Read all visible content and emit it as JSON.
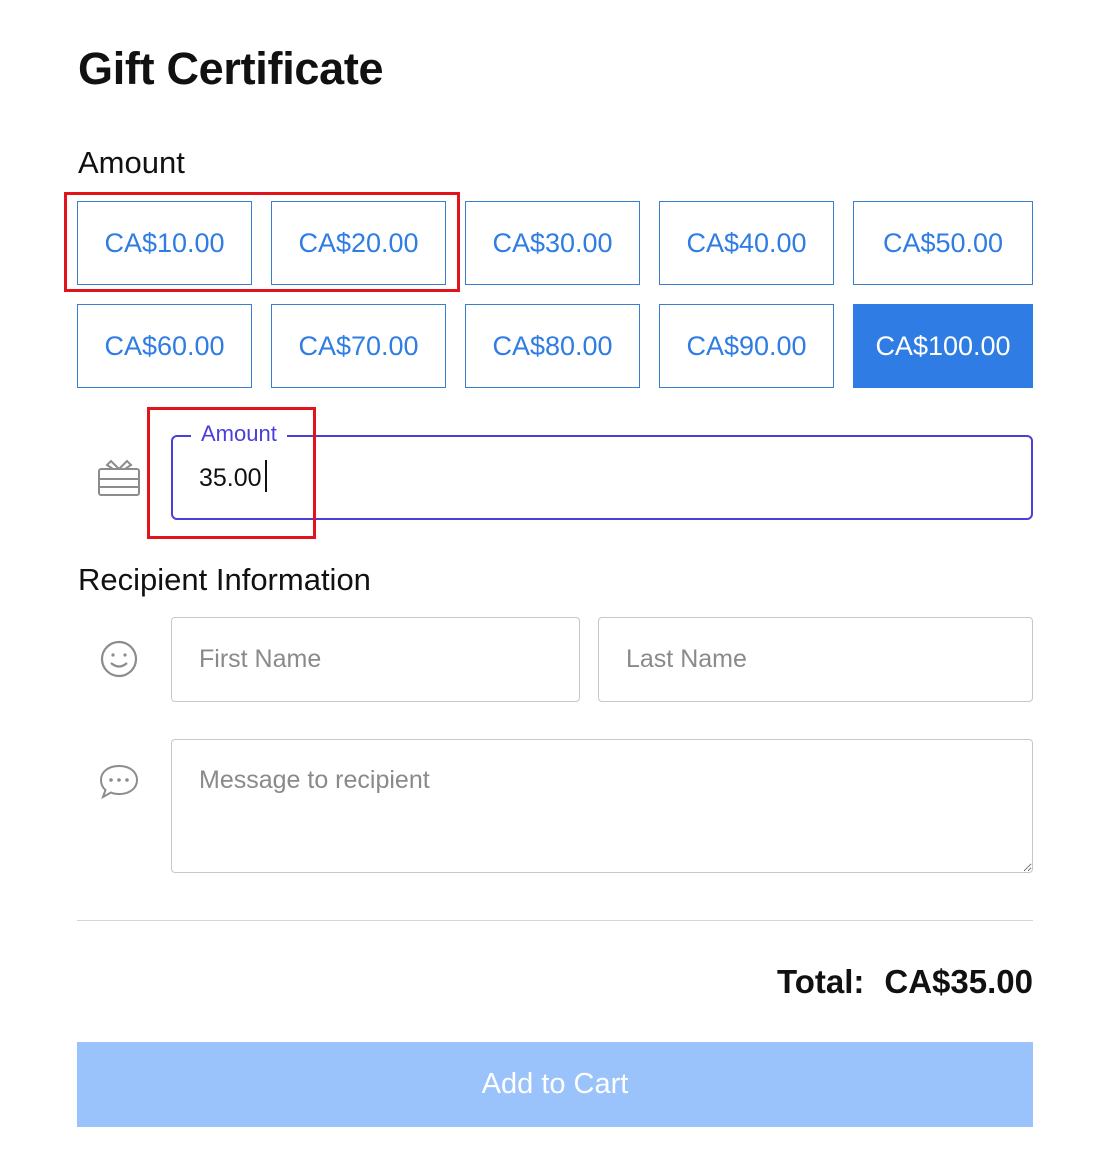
{
  "page": {
    "title": "Gift Certificate"
  },
  "amount_section": {
    "heading": "Amount",
    "options": [
      {
        "label": "CA$10.00",
        "selected": false
      },
      {
        "label": "CA$20.00",
        "selected": false
      },
      {
        "label": "CA$30.00",
        "selected": false
      },
      {
        "label": "CA$40.00",
        "selected": false
      },
      {
        "label": "CA$50.00",
        "selected": false
      },
      {
        "label": "CA$60.00",
        "selected": false
      },
      {
        "label": "CA$70.00",
        "selected": false
      },
      {
        "label": "CA$80.00",
        "selected": false
      },
      {
        "label": "CA$90.00",
        "selected": false
      },
      {
        "label": "CA$100.00",
        "selected": true
      }
    ],
    "custom_amount": {
      "label": "Amount",
      "value": "35.00",
      "icon": "gift-card-icon"
    }
  },
  "recipient_section": {
    "heading": "Recipient Information",
    "first_name": {
      "placeholder": "First Name",
      "value": ""
    },
    "last_name": {
      "placeholder": "Last Name",
      "value": ""
    },
    "message": {
      "placeholder": "Message to recipient",
      "value": ""
    },
    "name_icon": "smiley-icon",
    "message_icon": "chat-bubble-icon"
  },
  "summary": {
    "total_label": "Total:",
    "total_value": "CA$35.00"
  },
  "actions": {
    "add_to_cart_label": "Add to Cart"
  },
  "colors": {
    "accent": "#2f7de4",
    "focus": "#4b3ed9",
    "button_disabled": "#9ac2fb",
    "highlight": "#e0141a"
  }
}
